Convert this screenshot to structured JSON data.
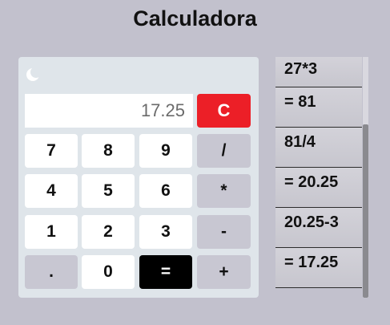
{
  "app": {
    "title": "Calculadora"
  },
  "calculator": {
    "display_value": "17.25",
    "clear_label": "C",
    "theme_icon": "moon-icon",
    "keys": {
      "seven": "7",
      "eight": "8",
      "nine": "9",
      "divide": "/",
      "four": "4",
      "five": "5",
      "six": "6",
      "multiply": "*",
      "one": "1",
      "two": "2",
      "three": "3",
      "subtract": "-",
      "decimal": ".",
      "zero": "0",
      "equals": "=",
      "add": "+"
    }
  },
  "history": {
    "items": [
      "27*3",
      "= 81",
      "81/4",
      "= 20.25",
      "20.25-3",
      "= 17.25"
    ]
  },
  "colors": {
    "background": "#c2c1cd",
    "panel": "#dfe5ea",
    "clear_button": "#ec1f27",
    "equals_button": "#000000",
    "operator_button": "#c8c7d2"
  }
}
